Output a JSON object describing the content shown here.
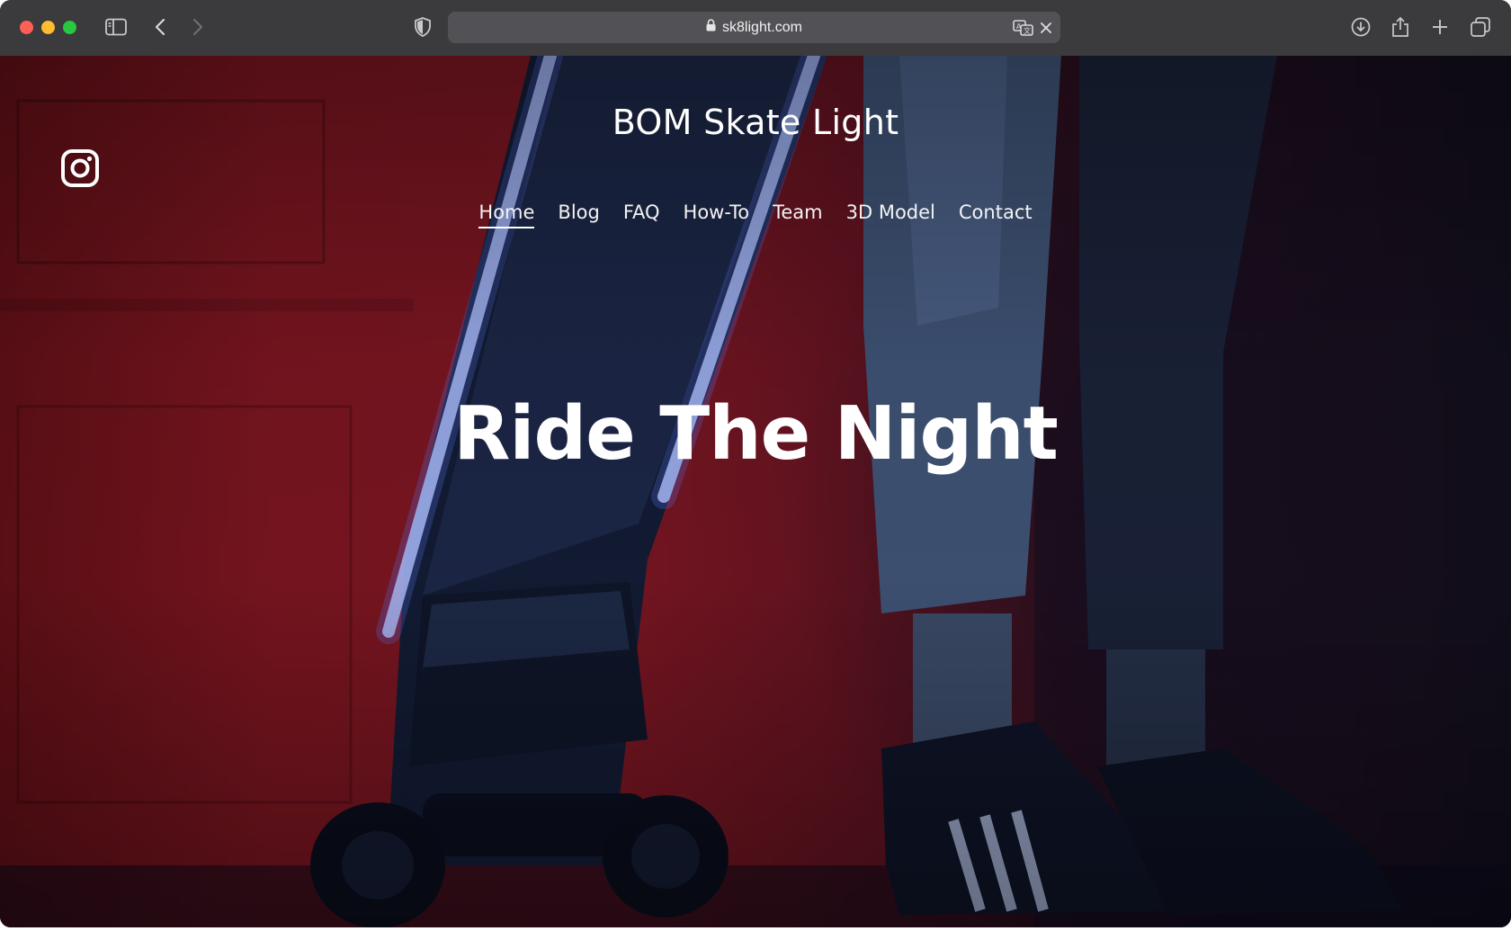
{
  "browser": {
    "url": "sk8light.com"
  },
  "site": {
    "title": "BOM Skate Light",
    "social_icon": "instagram-icon"
  },
  "nav": {
    "items": [
      {
        "label": "Home",
        "active": true
      },
      {
        "label": "Blog",
        "active": false
      },
      {
        "label": "FAQ",
        "active": false
      },
      {
        "label": "How-To",
        "active": false
      },
      {
        "label": "Team",
        "active": false
      },
      {
        "label": "3D Model",
        "active": false
      },
      {
        "label": "Contact",
        "active": false
      }
    ]
  },
  "hero": {
    "headline": "Ride The Night"
  },
  "colors": {
    "toolbar": "#3b3b3d",
    "url_bar": "#525256",
    "background_red": "#7a1520",
    "text": "#ffffff"
  }
}
